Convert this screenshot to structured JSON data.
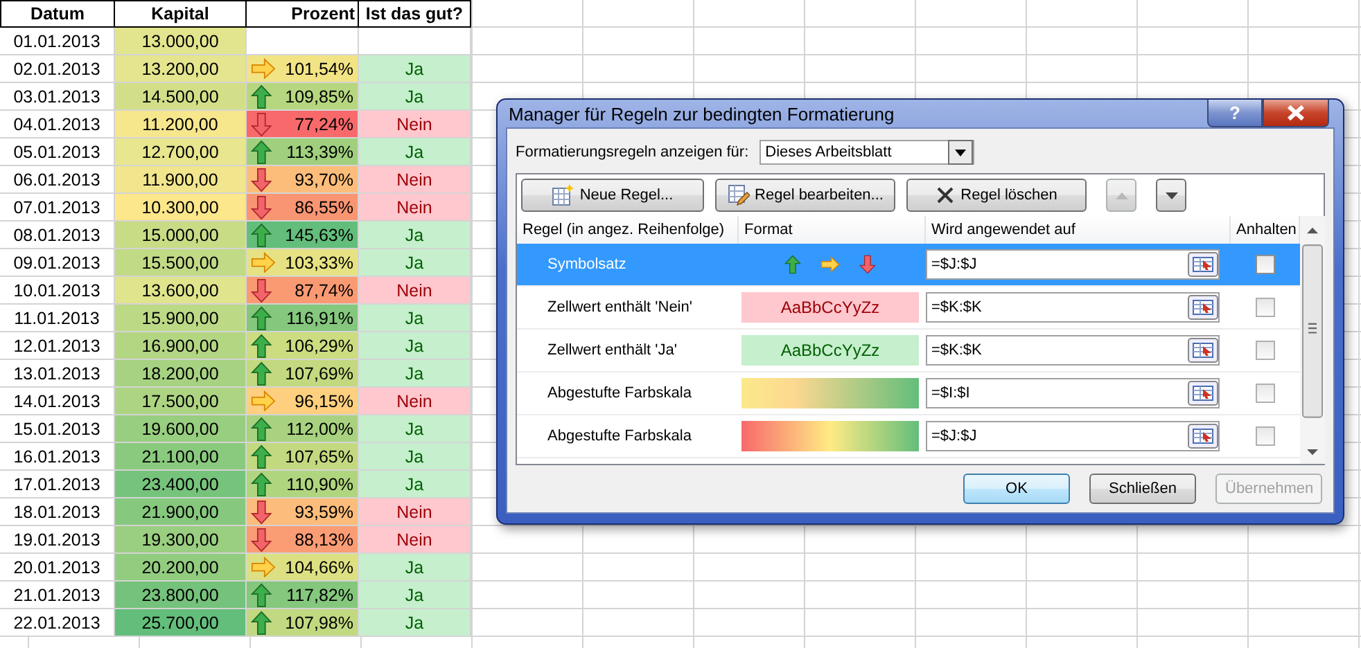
{
  "sheet": {
    "columns": [
      "Datum",
      "Kapital",
      "Prozent",
      "Ist das gut?"
    ],
    "rows": [
      {
        "date": "01.01.2013",
        "capital": {
          "text": "13.000,00",
          "color": "#e3e58e"
        },
        "percent": null,
        "verdict": null
      },
      {
        "date": "02.01.2013",
        "capital": {
          "text": "13.200,00",
          "color": "#e4e58e"
        },
        "percent": {
          "text": "101,54%",
          "kind": "right",
          "color": "#f2e384"
        },
        "verdict": {
          "text": "Ja",
          "kind": "good"
        }
      },
      {
        "date": "03.01.2013",
        "capital": {
          "text": "14.500,00",
          "color": "#d2df88"
        },
        "percent": {
          "text": "109,85%",
          "kind": "up",
          "color": "#b6d77f"
        },
        "verdict": {
          "text": "Ja",
          "kind": "good"
        }
      },
      {
        "date": "04.01.2013",
        "capital": {
          "text": "11.200,00",
          "color": "#f6e68c"
        },
        "percent": {
          "text": "77,24%",
          "kind": "down",
          "color": "#f8696b"
        },
        "verdict": {
          "text": "Nein",
          "kind": "bad"
        }
      },
      {
        "date": "05.01.2013",
        "capital": {
          "text": "12.700,00",
          "color": "#e8e68e"
        },
        "percent": {
          "text": "113,39%",
          "kind": "up",
          "color": "#a0d07e"
        },
        "verdict": {
          "text": "Ja",
          "kind": "good"
        }
      },
      {
        "date": "06.01.2013",
        "capital": {
          "text": "11.900,00",
          "color": "#f1e68d"
        },
        "percent": {
          "text": "93,70%",
          "kind": "down",
          "color": "#fcbd7b"
        },
        "verdict": {
          "text": "Nein",
          "kind": "bad"
        }
      },
      {
        "date": "07.01.2013",
        "capital": {
          "text": "10.300,00",
          "color": "#fde78b"
        },
        "percent": {
          "text": "86,55%",
          "kind": "down",
          "color": "#f99572"
        },
        "verdict": {
          "text": "Nein",
          "kind": "bad"
        }
      },
      {
        "date": "08.01.2013",
        "capital": {
          "text": "15.000,00",
          "color": "#c8dc86"
        },
        "percent": {
          "text": "145,63%",
          "kind": "up",
          "color": "#63be7b"
        },
        "verdict": {
          "text": "Ja",
          "kind": "good"
        }
      },
      {
        "date": "09.01.2013",
        "capital": {
          "text": "15.500,00",
          "color": "#c1da85"
        },
        "percent": {
          "text": "103,33%",
          "kind": "right",
          "color": "#e6e283"
        },
        "verdict": {
          "text": "Ja",
          "kind": "good"
        }
      },
      {
        "date": "10.01.2013",
        "capital": {
          "text": "13.600,00",
          "color": "#e0e48c"
        },
        "percent": {
          "text": "87,74%",
          "kind": "down",
          "color": "#fa9a73"
        },
        "verdict": {
          "text": "Nein",
          "kind": "bad"
        }
      },
      {
        "date": "11.01.2013",
        "capital": {
          "text": "15.900,00",
          "color": "#bcd985"
        },
        "percent": {
          "text": "116,91%",
          "kind": "up",
          "color": "#84c77d"
        },
        "verdict": {
          "text": "Ja",
          "kind": "good"
        }
      },
      {
        "date": "12.01.2013",
        "capital": {
          "text": "16.900,00",
          "color": "#b3d683"
        },
        "percent": {
          "text": "106,29%",
          "kind": "up",
          "color": "#cbdc81"
        },
        "verdict": {
          "text": "Ja",
          "kind": "good"
        }
      },
      {
        "date": "13.01.2013",
        "capital": {
          "text": "18.200,00",
          "color": "#a6d281"
        },
        "percent": {
          "text": "107,69%",
          "kind": "up",
          "color": "#c3d980"
        },
        "verdict": {
          "text": "Ja",
          "kind": "good"
        }
      },
      {
        "date": "14.01.2013",
        "capital": {
          "text": "17.500,00",
          "color": "#add482"
        },
        "percent": {
          "text": "96,15%",
          "kind": "right",
          "color": "#fdcf7e"
        },
        "verdict": {
          "text": "Nein",
          "kind": "bad"
        }
      },
      {
        "date": "15.01.2013",
        "capital": {
          "text": "19.600,00",
          "color": "#98ce7f"
        },
        "percent": {
          "text": "112,00%",
          "kind": "up",
          "color": "#a8d27f"
        },
        "verdict": {
          "text": "Ja",
          "kind": "good"
        }
      },
      {
        "date": "16.01.2013",
        "capital": {
          "text": "21.100,00",
          "color": "#8aca7e"
        },
        "percent": {
          "text": "107,65%",
          "kind": "up",
          "color": "#c3d980"
        },
        "verdict": {
          "text": "Ja",
          "kind": "good"
        }
      },
      {
        "date": "17.01.2013",
        "capital": {
          "text": "23.400,00",
          "color": "#76c37c"
        },
        "percent": {
          "text": "110,90%",
          "kind": "up",
          "color": "#b0d57f"
        },
        "verdict": {
          "text": "Ja",
          "kind": "good"
        }
      },
      {
        "date": "18.01.2013",
        "capital": {
          "text": "21.900,00",
          "color": "#86c87d"
        },
        "percent": {
          "text": "93,59%",
          "kind": "down",
          "color": "#fcbc7b"
        },
        "verdict": {
          "text": "Nein",
          "kind": "bad"
        }
      },
      {
        "date": "19.01.2013",
        "capital": {
          "text": "19.300,00",
          "color": "#9ace80"
        },
        "percent": {
          "text": "88,13%",
          "kind": "down",
          "color": "#fa9c74"
        },
        "verdict": {
          "text": "Nein",
          "kind": "bad"
        }
      },
      {
        "date": "20.01.2013",
        "capital": {
          "text": "20.200,00",
          "color": "#92cc7f"
        },
        "percent": {
          "text": "104,66%",
          "kind": "right",
          "color": "#dde082"
        },
        "verdict": {
          "text": "Ja",
          "kind": "good"
        }
      },
      {
        "date": "21.01.2013",
        "capital": {
          "text": "23.800,00",
          "color": "#74c27b"
        },
        "percent": {
          "text": "117,82%",
          "kind": "up",
          "color": "#84c77d"
        },
        "verdict": {
          "text": "Ja",
          "kind": "good"
        }
      },
      {
        "date": "22.01.2013",
        "capital": {
          "text": "25.700,00",
          "color": "#63be7b"
        },
        "percent": {
          "text": "107,98%",
          "kind": "up",
          "color": "#c1d980"
        },
        "verdict": {
          "text": "Ja",
          "kind": "good"
        }
      }
    ]
  },
  "dialog": {
    "title": "Manager für Regeln zur bedingten Formatierung",
    "help": "?",
    "scope_label": "Formatierungsregeln anzeigen für:",
    "scope_value": "Dieses Arbeitsblatt",
    "toolbar": [
      "Neue Regel...",
      "Regel bearbeiten...",
      "Regel löschen"
    ],
    "move_up": {
      "disabled": true
    },
    "move_down": {
      "disabled": false
    },
    "columns": [
      "Regel (in angez. Reihenfolge)",
      "Format",
      "Wird angewendet auf",
      "Anhalten"
    ],
    "rules": [
      {
        "name": "Symbolsatz",
        "format": {
          "kind": "icons"
        },
        "applies_to": "=$J:$J",
        "selected": true,
        "stop": false
      },
      {
        "name": "Zellwert enthält 'Nein'",
        "format": {
          "kind": "bad",
          "sample": "AaBbCcYyZz"
        },
        "applies_to": "=$K:$K",
        "selected": false,
        "stop": false
      },
      {
        "name": "Zellwert enthält 'Ja'",
        "format": {
          "kind": "good",
          "sample": "AaBbCcYyZz"
        },
        "applies_to": "=$K:$K",
        "selected": false,
        "stop": false
      },
      {
        "name": "Abgestufte Farbskala",
        "format": {
          "kind": "two_color_scale"
        },
        "applies_to": "=$I:$I",
        "selected": false,
        "stop": false
      },
      {
        "name": "Abgestufte Farbskala",
        "format": {
          "kind": "three_color_scale"
        },
        "applies_to": "=$J:$J",
        "selected": false,
        "stop": false
      }
    ],
    "buttons": [
      {
        "label": "OK",
        "disabled": false,
        "default": true
      },
      {
        "label": "Schließen",
        "disabled": false,
        "default": false
      },
      {
        "label": "Übernehmen",
        "disabled": true,
        "default": false
      }
    ]
  }
}
